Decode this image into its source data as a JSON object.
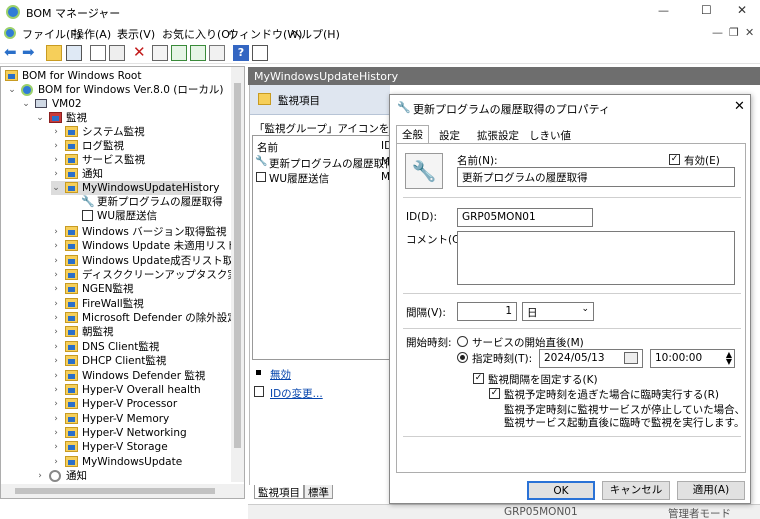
{
  "app": {
    "title": "BOM マネージャー"
  },
  "window_controls": {
    "minimize": "—",
    "maximize": "☐",
    "close": "✕",
    "child_min": "—",
    "child_restore": "❐",
    "child_close": "✕"
  },
  "menu": [
    "ファイル(F)",
    "操作(A)",
    "表示(V)",
    "お気に入り(O)",
    "ウィンドウ(W)",
    "ヘルプ(H)"
  ],
  "tree": {
    "root": "BOM for Windows Root",
    "instance": "BOM for Windows Ver.8.0 (ローカル)",
    "host": "VM02",
    "monitor": "監視",
    "groups": [
      "システム監視",
      "ログ監視",
      "サービス監視",
      "通知"
    ],
    "selected_group": "MyWindowsUpdateHistory",
    "sub_items": [
      "更新プログラムの履歴取得",
      "WU履歴送信"
    ],
    "groups_after": [
      "Windows バージョン取得監視",
      "Windows Update 未適用リスト取得監",
      "Windows Update成否リスト取得",
      "ディスククリーンアップタスク実行",
      "NGEN監視",
      "FireWall監視",
      "Microsoft Defender の除外設定監視",
      "朝監視",
      "DNS Client監視",
      "DHCP Client監視",
      "Windows Defender 監視",
      "Hyper-V  Overall health",
      "Hyper-V  Processor",
      "Hyper-V Memory",
      "Hyper-V Networking",
      "Hyper-V Storage",
      "MyWindowsUpdate"
    ],
    "notify": "通知"
  },
  "right_header": "MyWindowsUpdateHistory",
  "panel": {
    "title": "監視項目",
    "hint": "「監視グループ」アイコンを右クリックし",
    "col_name": "名前",
    "col_id": "ID",
    "rows": [
      {
        "name": "更新プログラムの履歴取得",
        "id": "M"
      },
      {
        "name": "WU履歴送信",
        "id": "M"
      }
    ],
    "link_disable": "無効",
    "link_change_id": "IDの変更...",
    "bottom_tabs": [
      "監視項目",
      "標準"
    ],
    "status_left": "GRP05MON01",
    "status_right": "管理者モード"
  },
  "dialog": {
    "title": "更新プログラムの履歴取得のプロパティ",
    "close": "✕",
    "tabs": [
      "全般",
      "設定",
      "拡張設定",
      "しきい値"
    ],
    "name_label": "名前(N):",
    "name_value": "更新プログラムの履歴取得",
    "enabled_label": "有効(E)",
    "id_label": "ID(D):",
    "id_value": "GRP05MON01",
    "comment_label": "コメント(C):",
    "interval_label": "間隔(V):",
    "interval_value": "1",
    "interval_unit": "日",
    "start_label": "開始時刻:",
    "radio_service": "サービスの開始直後(M)",
    "radio_time": "指定時刻(T):",
    "date_value": "2024/05/13",
    "time_value": "10:00:00",
    "fixed_interval": "監視間隔を固定する(K)",
    "run_immediately": "監視予定時刻を過ぎた場合に臨時実行する(R)",
    "note_1": "監視予定時刻に監視サービスが停止していた場合、",
    "note_2": "監視サービス起動直後に臨時で監視を実行します。",
    "ok": "OK",
    "cancel": "キャンセル",
    "apply": "適用(A)"
  }
}
